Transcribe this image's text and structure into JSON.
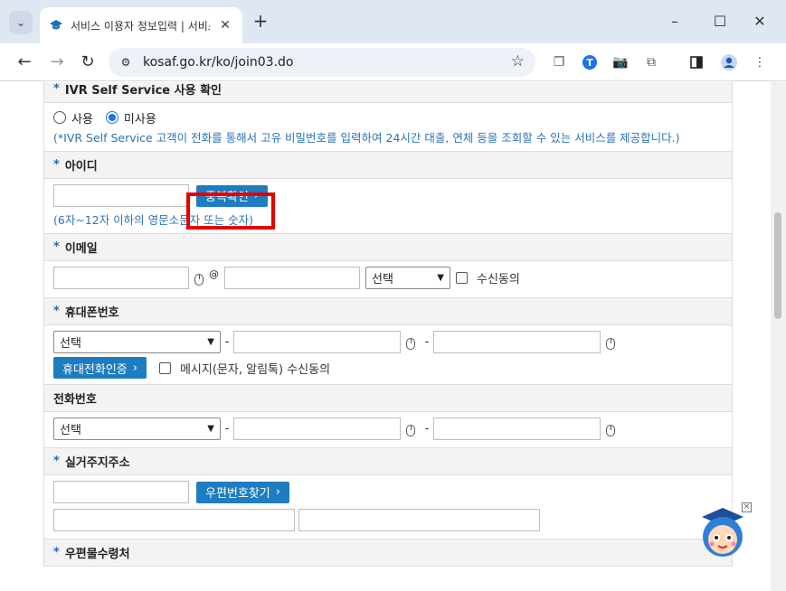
{
  "browser": {
    "tab_title": "서비스 이용자 정보입력 | 서비스 이용",
    "url": "kosaf.go.kr/ko/join03.do",
    "new_tab_label": "+",
    "window_controls": {
      "minimize": "–",
      "maximize": "☐",
      "close": "✕"
    }
  },
  "form": {
    "ivr": {
      "title": "IVR Self Service 사용 확인",
      "option_use": "사용",
      "option_nouse": "미사용",
      "hint": "(*IVR Self Service 고객이 전화를 통해서 고유 비밀번호를 입력하여 24시간 대출, 연체 등을 조회할 수 있는 서비스를 제공합니다.)"
    },
    "id": {
      "title": "아이디",
      "check_button": "중복확인",
      "hint": "(6자~12자 이하의 영문소문자 또는 숫자)"
    },
    "email": {
      "title": "이메일",
      "at_sign": "@",
      "domain_select": "선택",
      "consent_label": "수신동의"
    },
    "mobile": {
      "title": "휴대폰번호",
      "prefix_select": "선택",
      "dash": "-",
      "verify_button": "휴대전화인증",
      "consent_label": "메시지(문자, 알림톡) 수신동의"
    },
    "phone": {
      "title": "전화번호",
      "prefix_select": "선택",
      "dash": "-"
    },
    "address": {
      "title": "실거주지주소",
      "zipcode_button": "우편번호찾기"
    },
    "mail_recipient": {
      "title": "우편물수령처"
    },
    "required_mark": "*"
  },
  "colors": {
    "accent_blue": "#1e7dc1",
    "hint_blue": "#2b73b5",
    "highlight_red": "#e60000"
  }
}
